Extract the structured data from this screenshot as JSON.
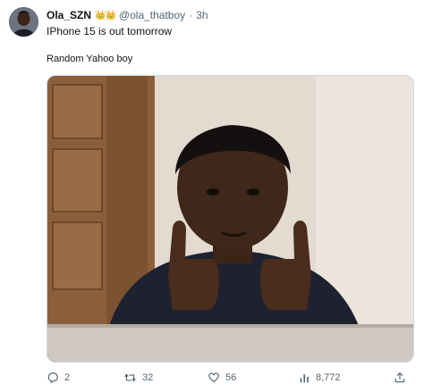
{
  "tweet": {
    "author": {
      "display_name": "Ola_SZN",
      "badges": "👑👑",
      "handle": "@ola_thatboy",
      "separator": "·",
      "timestamp": "3h"
    },
    "text": "IPhone 15 is out tomorrow",
    "media_caption": "Random Yahoo boy",
    "media_description": "photo of a child giving two thumbs up",
    "stats": {
      "replies": "2",
      "retweets": "32",
      "likes": "56",
      "views": "8,772"
    }
  },
  "icons": {
    "reply": "comment-icon",
    "retweet": "retweet-icon",
    "like": "heart-icon",
    "views": "views-chart-icon",
    "share": "share-icon"
  },
  "colors": {
    "text_primary": "#0f1419",
    "text_secondary": "#536471",
    "badge_gold": "#e9a91e"
  }
}
